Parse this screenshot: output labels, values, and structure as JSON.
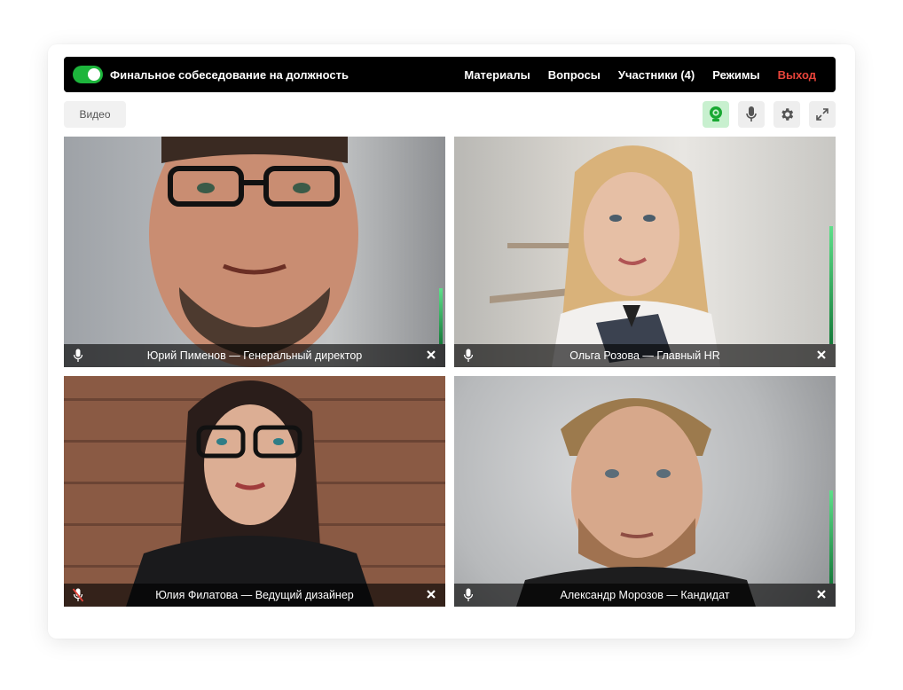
{
  "header": {
    "meeting_toggle_on": true,
    "title": "Финальное собеседование на должность",
    "nav": [
      "Материалы",
      "Вопросы",
      "Участники (4)",
      "Режимы"
    ],
    "exit_label": "Выход"
  },
  "toolbar": {
    "video_label": "Видео",
    "buttons": [
      "camera-icon",
      "microphone-icon",
      "gear-icon",
      "fullscreen-icon"
    ],
    "camera_active": true
  },
  "participants": [
    {
      "caption": "Юрий Пименов — Генеральный директор",
      "mic_muted": false,
      "audio_level": 0.27
    },
    {
      "caption": "Ольга Розова — Главный HR",
      "mic_muted": false,
      "audio_level": 0.57
    },
    {
      "caption": "Юлия Филатова — Ведущий дизайнер",
      "mic_muted": true,
      "audio_level": 0
    },
    {
      "caption": "Александр Морозов — Кандидат",
      "mic_muted": false,
      "audio_level": 0.45
    }
  ],
  "colors": {
    "accent_green": "#1db53c",
    "exit_red": "#e8443a",
    "muted_red": "#e8443a"
  }
}
